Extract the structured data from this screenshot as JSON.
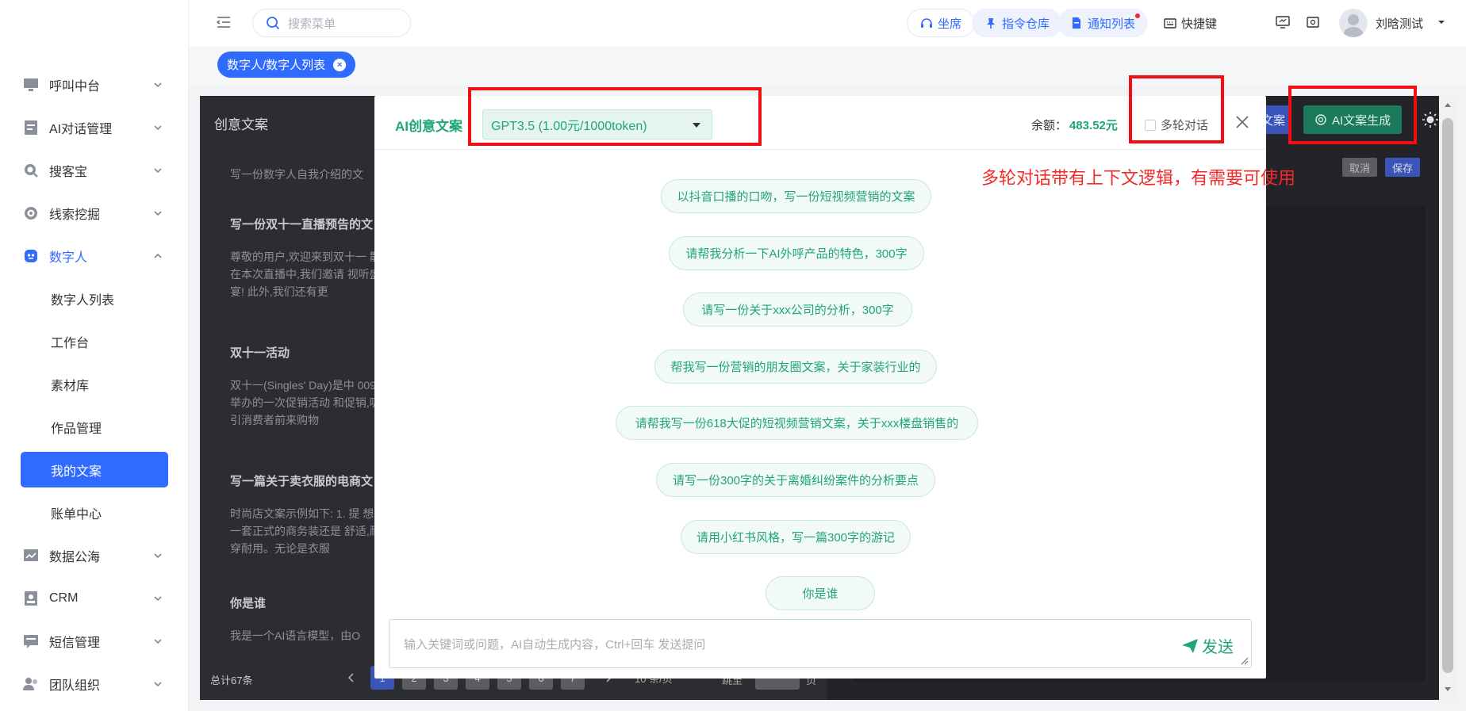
{
  "sidebar": {
    "items": [
      {
        "label": "呼叫中台",
        "icon": "monitor-icon"
      },
      {
        "label": "AI对话管理",
        "icon": "document-icon"
      },
      {
        "label": "搜客宝",
        "icon": "search-circle-icon"
      },
      {
        "label": "线索挖掘",
        "icon": "target-icon"
      },
      {
        "label": "数字人",
        "icon": "robot-icon"
      }
    ],
    "sub_items": [
      {
        "label": "数字人列表"
      },
      {
        "label": "工作台"
      },
      {
        "label": "素材库"
      },
      {
        "label": "作品管理"
      },
      {
        "label": "我的文案"
      },
      {
        "label": "账单中心"
      }
    ],
    "items_after": [
      {
        "label": "数据公海",
        "icon": "chart-icon"
      },
      {
        "label": "CRM",
        "icon": "contact-card-icon"
      },
      {
        "label": "短信管理",
        "icon": "message-icon"
      },
      {
        "label": "团队组织",
        "icon": "team-icon"
      }
    ],
    "active_color": "#2f6bff"
  },
  "topbar": {
    "search_placeholder": "搜索菜单",
    "seat_label": "坐席",
    "command_label": "指令仓库",
    "notice_label": "通知列表",
    "shortcut_label": "快捷键",
    "username": "刘晗测试"
  },
  "tabs": {
    "current": "数字人/数字人列表"
  },
  "background_page": {
    "title": "创意文案",
    "entries": [
      {
        "heading": "",
        "text": "写一份数字人自我介绍的文"
      },
      {
        "heading": "写一份双十一直播预告的文",
        "text": "尊敬的用户,欢迎来到双十一 散! 在本次直播中,我们邀请 视听盛宴! 此外,我们还有更"
      },
      {
        "heading": "双十一活动",
        "text": "双十一(Singles' Day)是中 009年举办的一次促销活动 和促销,吸引消费者前来购物"
      },
      {
        "heading": "写一篇关于卖衣服的电商文",
        "text": "时尚店文案示例如下: 1. 提 想要一套正式的商务装还是 舒适,耐穿耐用。无论是衣服"
      },
      {
        "heading": "你是谁",
        "text": "我是一个AI语言模型，由O"
      }
    ],
    "total": "总计67条",
    "pages": [
      "1",
      "2",
      "3",
      "4",
      "5",
      "6",
      "7"
    ],
    "page_size": "10 条/页",
    "goto_label": "跳至",
    "page_unit": "页",
    "cancel_label": "取消",
    "save_label": "保存",
    "copy_label": "文案",
    "ai_generate_label": "AI文案生成"
  },
  "modal": {
    "title": "AI创意文案",
    "model": "GPT3.5 (1.00元/1000token)",
    "balance_label": "余额：",
    "balance_value": "483.52元",
    "multi_turn_label": "多轮对话",
    "suggestions": [
      "以抖音口播的口吻，写一份短视频营销的文案",
      "请帮我分析一下AI外呼产品的特色，300字",
      "请写一份关于xxx公司的分析，300字",
      "帮我写一份营销的朋友圈文案，关于家装行业的",
      "请帮我写一份618大促的短视频营销文案，关于xxx楼盘销售的",
      "请写一份300字的关于离婚纠纷案件的分析要点",
      "请用小红书风格，写一篇300字的游记",
      "你是谁"
    ],
    "input_placeholder": "输入关键词或问题，AI自动生成内容，Ctrl+回车 发送提问",
    "send_label": "发送",
    "accent_color": "#20a47d"
  },
  "annotation": {
    "text": "多轮对话带有上下文逻辑，有需要可使用",
    "color": "#f40e14"
  }
}
